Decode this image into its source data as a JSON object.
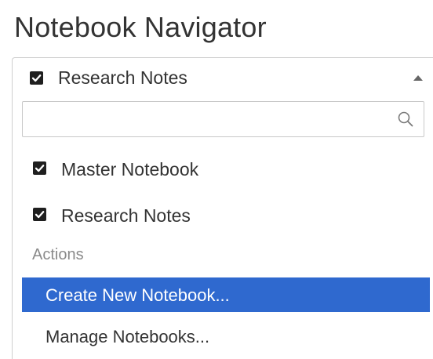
{
  "title": "Notebook Navigator",
  "dropdown": {
    "selected_label": "Research Notes",
    "checked": true,
    "expanded": true
  },
  "search": {
    "value": "",
    "placeholder": ""
  },
  "notebooks": [
    {
      "label": "Master Notebook",
      "checked": true
    },
    {
      "label": "Research Notes",
      "checked": true
    }
  ],
  "actions": {
    "heading": "Actions",
    "items": [
      {
        "label": "Create New Notebook...",
        "selected": true
      },
      {
        "label": "Manage Notebooks...",
        "selected": false
      }
    ]
  },
  "colors": {
    "selection": "#2f69cf",
    "text": "#333333",
    "heading": "#8a8a8a",
    "checkbox": "#1f1f1f"
  },
  "icons": {
    "collapse": "chevron-up-icon",
    "search": "search-icon",
    "checkbox": "checkbox-checked-icon"
  }
}
